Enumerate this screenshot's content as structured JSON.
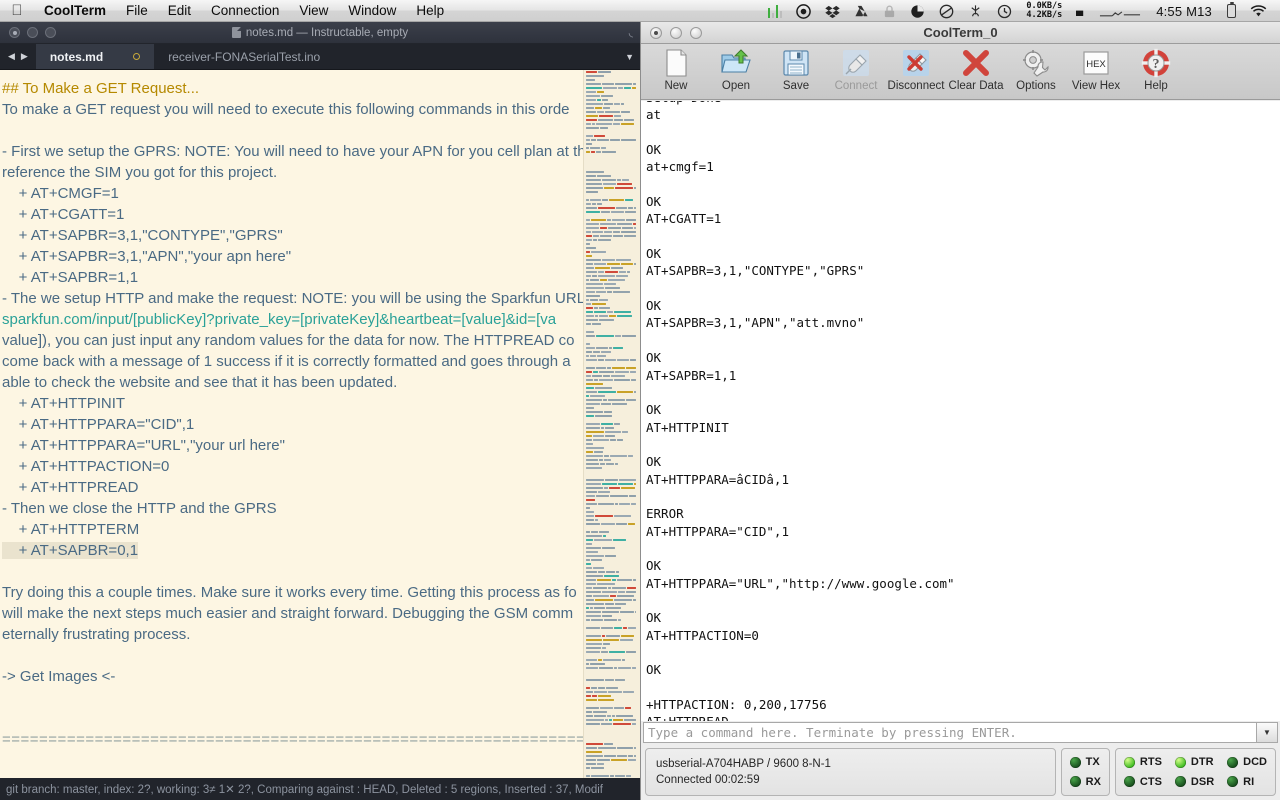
{
  "menubar": {
    "apple": "apple-logo",
    "items": [
      {
        "label": "CoolTerm",
        "bold": true
      },
      {
        "label": "File"
      },
      {
        "label": "Edit"
      },
      {
        "label": "Connection"
      },
      {
        "label": "View"
      },
      {
        "label": "Window"
      },
      {
        "label": "Help"
      }
    ],
    "status": {
      "network_up": "0.0KB/s",
      "network_down": "4.2KB/s",
      "clock": "4:55 M13",
      "icons": [
        "equalizer-icon",
        "record-icon",
        "dropbox-icon",
        "google-drive-icon",
        "lock-icon",
        "pie-timer-icon",
        "crashplan-icon",
        "stickies-icon",
        "time-machine-icon",
        "network-speed-icon",
        "stop-icon",
        "graph-icon",
        "battery-icon",
        "wifi-icon"
      ]
    }
  },
  "editor": {
    "title": "notes.md — Instructable, empty",
    "title_icon": "document-icon",
    "expand_icon": "expand-icon",
    "window_buttons": [
      "close",
      "minimize",
      "zoom"
    ],
    "tabs": [
      {
        "label": "notes.md",
        "active": true,
        "dirty": true
      },
      {
        "label": "receiver-FONASerialTest.ino",
        "active": false,
        "dirty": false
      }
    ],
    "tab_nav": {
      "prev": "prev-tab-arrow",
      "next": "next-tab-arrow",
      "menu": "tab-overflow-icon"
    },
    "lines": [
      {
        "t": "## To Make a GET Request...",
        "c": "h2"
      },
      {
        "t": "To make a GET request you will need to execute this following commands in this orde",
        "c": ""
      },
      {
        "t": "",
        "c": ""
      },
      {
        "t": "- First we setup the GPRS: NOTE: You will need to have your APN for you cell plan at th",
        "c": ""
      },
      {
        "t": "reference the SIM you got for this project.",
        "c": ""
      },
      {
        "t": "    + AT+CMGF=1",
        "c": ""
      },
      {
        "t": "    + AT+CGATT=1",
        "c": ""
      },
      {
        "t": "    + AT+SAPBR=3,1,\"CONTYPE\",\"GPRS\"",
        "c": ""
      },
      {
        "t": "    + AT+SAPBR=3,1,\"APN\",\"your apn here\"",
        "c": ""
      },
      {
        "t": "    + AT+SAPBR=1,1",
        "c": ""
      },
      {
        "t": "- The we setup HTTP and make the request: NOTE: you will be using the Sparkfun URL",
        "c": ""
      },
      {
        "t": "sparkfun.com/input/[publicKey]?private_key=[privateKey]&heartbeat=[value]&id=[va",
        "c": "link"
      },
      {
        "t": "value]), you can just input any random values for the data for now. The HTTPREAD co",
        "c": ""
      },
      {
        "t": "come back with a message of 1 success if it is correctly formatted and goes through a",
        "c": ""
      },
      {
        "t": "able to check the website and see that it has been updated.",
        "c": ""
      },
      {
        "t": "    + AT+HTTPINIT",
        "c": ""
      },
      {
        "t": "    + AT+HTTPPARA=\"CID\",1",
        "c": ""
      },
      {
        "t": "    + AT+HTTPPARA=\"URL\",\"your url here\"",
        "c": ""
      },
      {
        "t": "    + AT+HTTPACTION=0",
        "c": ""
      },
      {
        "t": "    + AT+HTTPREAD",
        "c": ""
      },
      {
        "t": "- Then we close the HTTP and the GPRS",
        "c": ""
      },
      {
        "t": "    + AT+HTTPTERM",
        "c": ""
      },
      {
        "t": "    + AT+SAPBR=0,1",
        "c": "sel"
      },
      {
        "t": "",
        "c": ""
      },
      {
        "t": "Try doing this a couple times. Make sure it works every time. Getting this process as fo",
        "c": ""
      },
      {
        "t": "will make the next steps much easier and straight forward. Debugging the GSM comm",
        "c": ""
      },
      {
        "t": "eternally frustrating process.",
        "c": ""
      },
      {
        "t": "",
        "c": ""
      },
      {
        "t": "-> Get Images <-",
        "c": ""
      },
      {
        "t": "",
        "c": ""
      },
      {
        "t": "",
        "c": ""
      },
      {
        "t": "=================================================================",
        "c": "eq-rule"
      }
    ],
    "status_text": "git branch: master, index: 2?, working: 3≠ 1✕ 2?, Comparing against : HEAD, Deleted : 5 regions, Inserted : 37, Modif",
    "minimap_name": "minimap"
  },
  "coolterm": {
    "title": "CoolTerm_0",
    "window_buttons": [
      "close",
      "minimize",
      "zoom"
    ],
    "toolbar": [
      {
        "label": "New",
        "icon": "new-document-icon",
        "disabled": false
      },
      {
        "label": "Open",
        "icon": "open-folder-icon",
        "disabled": false
      },
      {
        "label": "Save",
        "icon": "save-floppy-icon",
        "disabled": false
      },
      {
        "label": "Connect",
        "icon": "connect-plug-icon",
        "disabled": true
      },
      {
        "label": "Disconnect",
        "icon": "disconnect-plug-icon",
        "disabled": false
      },
      {
        "label": "Clear Data",
        "icon": "clear-x-icon",
        "disabled": false
      },
      {
        "label": "Options",
        "icon": "gear-wrench-icon",
        "disabled": false
      },
      {
        "label": "View Hex",
        "icon": "hex-icon",
        "disabled": false
      },
      {
        "label": "Help",
        "icon": "help-lifering-icon",
        "disabled": false
      }
    ],
    "terminal_lines": [
      "Setup Done",
      "at",
      "",
      "OK",
      "at+cmgf=1",
      "",
      "OK",
      "AT+CGATT=1",
      "",
      "OK",
      "AT+SAPBR=3,1,\"CONTYPE\",\"GPRS\"",
      "",
      "OK",
      "AT+SAPBR=3,1,\"APN\",\"att.mvno\"",
      "",
      "OK",
      "AT+SAPBR=1,1",
      "",
      "OK",
      "AT+HTTPINIT",
      "",
      "OK",
      "AT+HTTPPARA=âCIDâ,1",
      "",
      "ERROR",
      "AT+HTTPPARA=\"CID\",1",
      "",
      "OK",
      "AT+HTTPPARA=\"URL\",\"http://www.google.com\"",
      "",
      "OK",
      "AT+HTTPACTION=0",
      "",
      "OK",
      "",
      "+HTTPACTION: 0,200,17756",
      "AT+HTTPREAD"
    ],
    "command_input": {
      "value": "",
      "placeholder": "Type a command here. Terminate by pressing ENTER.",
      "dropdown_icon": "chevron-down-icon"
    },
    "connection": {
      "port_line": "usbserial-A704HABP / 9600 8-N-1",
      "status_line": "Connected 00:02:59"
    },
    "leds_tx": [
      {
        "label": "TX",
        "on": false
      },
      {
        "label": "RX",
        "on": false
      }
    ],
    "leds_signals": [
      {
        "label": "RTS",
        "on": true
      },
      {
        "label": "CTS",
        "on": false
      },
      {
        "label": "DTR",
        "on": true
      },
      {
        "label": "DSR",
        "on": false
      },
      {
        "label": "DCD",
        "on": false
      },
      {
        "label": "RI",
        "on": false
      }
    ]
  },
  "colors": {
    "editor_bg": "#fdf6e3",
    "editor_text": "#4a6a84",
    "heading": "#b58900",
    "link": "#2aa198",
    "chrome_dark": "#21242b",
    "terminal_bg": "#ffffff",
    "led_on": "#3fbb22",
    "led_off": "#2a5f2a"
  }
}
